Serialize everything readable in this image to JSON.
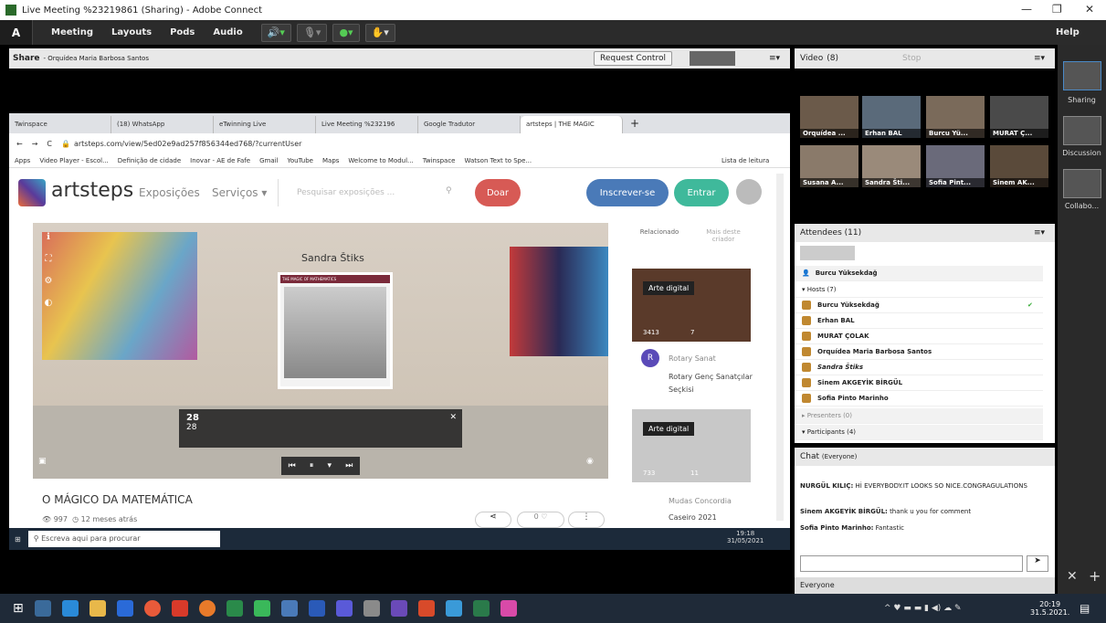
{
  "window": {
    "title": "Live Meeting %23219861 (Sharing) - Adobe Connect",
    "min": "—",
    "max": "❐",
    "close": "✕"
  },
  "menubar": {
    "logo": "Adobe",
    "items": [
      "Meeting",
      "Layouts",
      "Pods",
      "Audio"
    ],
    "help": "Help"
  },
  "share": {
    "title": "Share",
    "presenter": "- Orquídea Maria Barbosa Santos",
    "request_control": "Request Control"
  },
  "browser": {
    "tabs": [
      "Twinspace",
      "(18) WhatsApp",
      "eTwinning Live",
      "Live Meeting %232196",
      "Google Tradutor",
      "artsteps | THE MAGIC"
    ],
    "url": "artsteps.com/view/5ed02e9ad257f856344ed768/?currentUser",
    "bookmarks": [
      "Apps",
      "Video Player - Escol...",
      "Definição de cidade",
      "Inovar - AE de Fafe",
      "Gmail",
      "YouTube",
      "Maps",
      "Welcome to Modul...",
      "Twinspace",
      "Watson Text to Spe..."
    ],
    "reading_list": "Lista de leitura"
  },
  "artsteps": {
    "logo": "artsteps",
    "nav_exhibitions": "Exposições",
    "nav_services": "Serviços ▾",
    "search_placeholder": "Pesquisar exposições ...",
    "donate": "Doar",
    "signup": "Inscrever-se",
    "login": "Entrar",
    "gallery_artist": "Sandra Štiks",
    "poster_title": "THE MAGIC OF MATHEMATICS",
    "counter_big": "28",
    "counter_small": "28",
    "exhibit_title": "O MÁGICO DA MATEMÁTICA",
    "views": "997",
    "date": "12 meses atrás",
    "likes": "0",
    "related_tab": "Relacionado",
    "more_tab": "Mais deste criador",
    "card1": {
      "badge": "Arte digital",
      "views": "3413",
      "count": "7",
      "author_initial": "R",
      "author": "Rotary Sanat",
      "title": "Rotary Genç Sanatçılar Seçkisi"
    },
    "card2": {
      "badge": "Arte digital",
      "views": "733",
      "count": "11",
      "author": "Mudas Concordia",
      "title": "Caseiro 2021"
    }
  },
  "inner_taskbar": {
    "search": "Escreva aqui para procurar",
    "time": "19:18",
    "date": "31/05/2021"
  },
  "video": {
    "title": "Video",
    "count": "(8)",
    "stop": "Stop",
    "tiles": [
      "Orquídea ...",
      "Erhan BAL",
      "Burcu Yü...",
      "MURAT Ç...",
      "Susana A...",
      "Sandra Šti...",
      "Sofia Pint...",
      "Sinem AK..."
    ]
  },
  "attendees": {
    "title": "Attendees",
    "count": "(11)",
    "current_user": "Burcu Yüksekdağ",
    "hosts_label": "Hosts (7)",
    "hosts": [
      "Burcu Yüksekdağ",
      "Erhan BAL",
      "MURAT ÇOLAK",
      "Orquídea Maria Barbosa Santos",
      "Sandra Štiks",
      "Sinem AKGEYİK BİRGÜL",
      "Sofia Pinto Marinho"
    ],
    "presenters_label": "Presenters (0)",
    "participants_label": "Participants (4)"
  },
  "chat": {
    "title": "Chat",
    "scope": "(Everyone)",
    "messages": [
      {
        "author": "NURGÜL KILIÇ:",
        "text": "Hİ EVERYBODY.IT LOOKS SO NICE.CONGRAGULATIONS"
      },
      {
        "author": "Sinem AKGEYİK BİRGÜL:",
        "text": "thank u you for comment"
      },
      {
        "author": "Sofia Pinto Marinho:",
        "text": "Fantastic"
      }
    ],
    "recipient": "Everyone"
  },
  "sidebar": {
    "layouts": [
      "Sharing",
      "Discussion",
      "Collabo..."
    ]
  },
  "taskbar": {
    "time": "20:19",
    "date": "31.5.2021."
  }
}
